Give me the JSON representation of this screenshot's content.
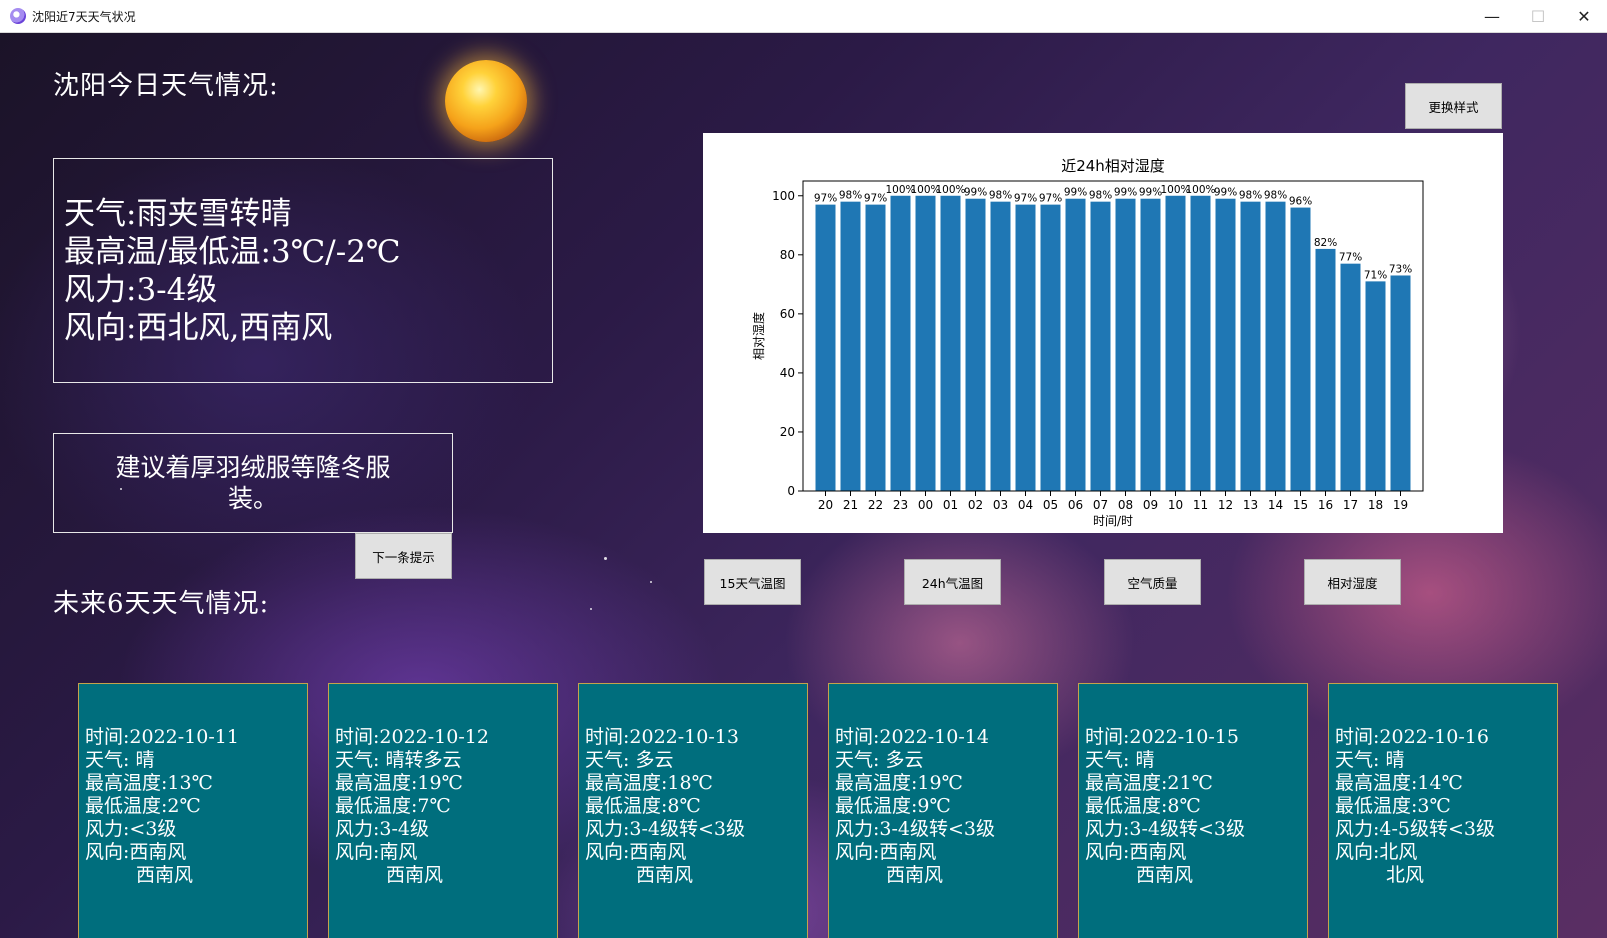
{
  "window": {
    "title": "沈阳近7天天气状况",
    "minimize": "—",
    "maximize": "☐",
    "close": "✕"
  },
  "today": {
    "heading": "沈阳今日天气情况:",
    "weather": "天气:雨夹雪转晴",
    "temp": "最高温/最低温:3℃/-2℃",
    "wind_force": "风力:3-4级",
    "wind_dir": "风向:西北风,西南风"
  },
  "tip": {
    "text": "建议着厚羽绒服等隆冬服装。",
    "next_button": "下一条提示"
  },
  "style_button": "更换样式",
  "future_heading": "未来6天天气情况:",
  "chart_buttons": [
    "15天气温图",
    "24h气温图",
    "空气质量",
    "相对湿度"
  ],
  "chart_data": {
    "type": "bar",
    "title": "近24h相对湿度",
    "xlabel": "时间/时",
    "ylabel": "相对湿度",
    "categories": [
      "20",
      "21",
      "22",
      "23",
      "00",
      "01",
      "02",
      "03",
      "04",
      "05",
      "06",
      "07",
      "08",
      "09",
      "10",
      "11",
      "12",
      "13",
      "14",
      "15",
      "16",
      "17",
      "18",
      "19"
    ],
    "values": [
      97,
      98,
      97,
      100,
      100,
      100,
      99,
      98,
      97,
      97,
      99,
      98,
      99,
      99,
      100,
      100,
      99,
      98,
      98,
      96,
      82,
      77,
      71,
      73
    ],
    "data_labels": [
      "97%",
      "98%",
      "97%",
      "100%",
      "100%",
      "100%",
      "99%",
      "98%",
      "97%",
      "97%",
      "99%",
      "98%",
      "99%",
      "99%",
      "100%",
      "100%",
      "99%",
      "98%",
      "98%",
      "96%",
      "82%",
      "77%",
      "71%",
      "73%"
    ],
    "ylim": [
      0,
      105
    ],
    "yticks": [
      0,
      20,
      40,
      60,
      80,
      100
    ],
    "bar_color": "#1f77b4",
    "grid": false
  },
  "forecast": [
    {
      "date": "时间:2022-10-11",
      "weather": "天气: 晴",
      "high": "最高温度:13℃",
      "low": "最低温度:2℃",
      "wind_force": "风力:<3级",
      "wind_dir": "风向:西南风",
      "wind_dir2": "西南风"
    },
    {
      "date": "时间:2022-10-12",
      "weather": "天气: 晴转多云",
      "high": "最高温度:19℃",
      "low": "最低温度:7℃",
      "wind_force": "风力:3-4级",
      "wind_dir": "风向:南风",
      "wind_dir2": "西南风"
    },
    {
      "date": "时间:2022-10-13",
      "weather": "天气: 多云",
      "high": "最高温度:18℃",
      "low": "最低温度:8℃",
      "wind_force": "风力:3-4级转<3级",
      "wind_dir": "风向:西南风",
      "wind_dir2": "西南风"
    },
    {
      "date": "时间:2022-10-14",
      "weather": "天气: 多云",
      "high": "最高温度:19℃",
      "low": "最低温度:9℃",
      "wind_force": "风力:3-4级转<3级",
      "wind_dir": "风向:西南风",
      "wind_dir2": "西南风"
    },
    {
      "date": "时间:2022-10-15",
      "weather": "天气: 晴",
      "high": "最高温度:21℃",
      "low": "最低温度:8℃",
      "wind_force": "风力:3-4级转<3级",
      "wind_dir": "风向:西南风",
      "wind_dir2": "西南风"
    },
    {
      "date": "时间:2022-10-16",
      "weather": "天气: 晴",
      "high": "最高温度:14℃",
      "low": "最低温度:3℃",
      "wind_force": "风力:4-5级转<3级",
      "wind_dir": "风向:北风",
      "wind_dir2": "北风"
    }
  ]
}
